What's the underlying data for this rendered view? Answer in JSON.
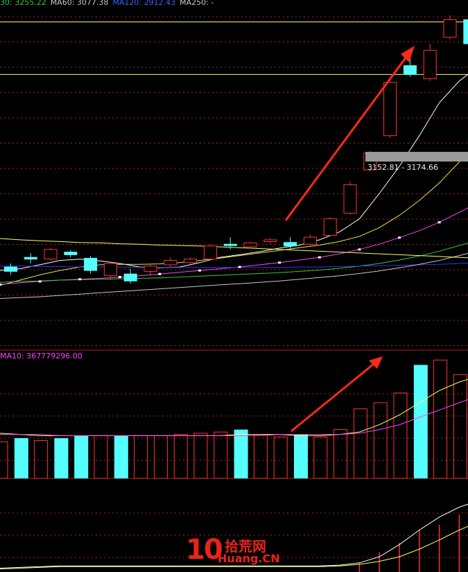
{
  "legend": {
    "items": [
      {
        "text": "30: 3255.22",
        "color": "#33cc33"
      },
      {
        "text": "MA60: 3077.38",
        "color": "#c8c8c8"
      },
      {
        "text": "MA120: 2912.43",
        "color": "#3366ff"
      },
      {
        "text": "MA250: -",
        "color": "#c8c8c8"
      }
    ]
  },
  "volume_legend": {
    "text": "MA10: 367779296.00",
    "color": "#ff44ff"
  },
  "range_label": "3152.81 - 3174.66",
  "logo": {
    "num": "10",
    "cn": "拾荒网",
    "en": "Huang.CN"
  },
  "colors": {
    "up": "#ff3333",
    "down": "#55ffff",
    "grid": "#aa2222"
  },
  "chart_data": [
    {
      "type": "candlestick",
      "panel": "price",
      "ylim": [
        2600,
        3400
      ],
      "hlines": [
        3350,
        3230
      ],
      "candles": [
        {
          "o": 2790,
          "c": 2780,
          "h": 2798,
          "l": 2772
        },
        {
          "o": 2812,
          "c": 2808,
          "h": 2822,
          "l": 2798
        },
        {
          "o": 2808,
          "c": 2830,
          "h": 2834,
          "l": 2805
        },
        {
          "o": 2824,
          "c": 2818,
          "h": 2828,
          "l": 2812
        },
        {
          "o": 2810,
          "c": 2782,
          "h": 2815,
          "l": 2775
        },
        {
          "o": 2770,
          "c": 2798,
          "h": 2800,
          "l": 2760
        },
        {
          "o": 2774,
          "c": 2758,
          "h": 2785,
          "l": 2752
        },
        {
          "o": 2780,
          "c": 2792,
          "h": 2795,
          "l": 2772
        },
        {
          "o": 2795,
          "c": 2805,
          "h": 2812,
          "l": 2790
        },
        {
          "o": 2800,
          "c": 2808,
          "h": 2812,
          "l": 2796
        },
        {
          "o": 2808,
          "c": 2838,
          "h": 2842,
          "l": 2805
        },
        {
          "o": 2842,
          "c": 2840,
          "h": 2858,
          "l": 2830
        },
        {
          "o": 2836,
          "c": 2845,
          "h": 2848,
          "l": 2832
        },
        {
          "o": 2848,
          "c": 2852,
          "h": 2856,
          "l": 2843
        },
        {
          "o": 2846,
          "c": 2838,
          "h": 2858,
          "l": 2832
        },
        {
          "o": 2842,
          "c": 2858,
          "h": 2864,
          "l": 2838
        },
        {
          "o": 2862,
          "c": 2900,
          "h": 2904,
          "l": 2860
        },
        {
          "o": 2913,
          "c": 2978,
          "h": 2985,
          "l": 2910
        },
        {
          "o": 3012,
          "c": 3050,
          "h": 3055,
          "l": 3008
        },
        {
          "o": 3090,
          "c": 3212,
          "h": 3214,
          "l": 3085
        },
        {
          "o": 3250,
          "c": 3230,
          "h": 3280,
          "l": 3225
        },
        {
          "o": 3220,
          "c": 3285,
          "h": 3300,
          "l": 3215
        },
        {
          "o": 3315,
          "c": 3355,
          "h": 3365,
          "l": 3310
        },
        {
          "o": 3355,
          "c": 3300,
          "h": 3370,
          "l": 3290
        }
      ],
      "series": [
        {
          "color": "#ffffff",
          "values": [
            2782,
            2786,
            2795,
            2805,
            2808,
            2804,
            2798,
            2790,
            2788,
            2790,
            2800,
            2812,
            2818,
            2825,
            2833,
            2840,
            2852,
            2870,
            2900,
            2958,
            3020,
            3090,
            3165,
            3215,
            3250
          ]
        },
        {
          "color": "#e8e84a",
          "values": [
            2748,
            2760,
            2772,
            2782,
            2790,
            2795,
            2796,
            2796,
            2797,
            2800,
            2805,
            2810,
            2816,
            2822,
            2828,
            2834,
            2840,
            2848,
            2860,
            2880,
            2908,
            2942,
            2982,
            3030,
            3080
          ]
        },
        {
          "color": "#ff44ff",
          "values": [
            2750,
            2754,
            2757,
            2760,
            2762,
            2764,
            2767,
            2770,
            2774,
            2778,
            2782,
            2786,
            2790,
            2795,
            2800,
            2806,
            2812,
            2820,
            2830,
            2842,
            2857,
            2873,
            2892,
            2915,
            2938
          ]
        },
        {
          "color": "#33cc33",
          "values": [
            2755,
            2757,
            2758,
            2760,
            2761,
            2762,
            2763,
            2764,
            2765,
            2767,
            2769,
            2771,
            2773,
            2775,
            2777,
            2780,
            2783,
            2787,
            2792,
            2798,
            2806,
            2815,
            2826,
            2839,
            2852
          ]
        },
        {
          "color": "#3333ff",
          "values": [
            2792,
            2792,
            2791,
            2791,
            2790,
            2790,
            2790,
            2789,
            2789,
            2789,
            2789,
            2789,
            2789,
            2789,
            2789,
            2790,
            2790,
            2791,
            2792,
            2793,
            2794,
            2795,
            2796,
            2798,
            2800
          ]
        },
        {
          "color": "#c8c8c8",
          "values": [
            2718,
            2720,
            2722,
            2725,
            2728,
            2731,
            2734,
            2737,
            2740,
            2743,
            2746,
            2749,
            2752,
            2755,
            2758,
            2762,
            2766,
            2770,
            2775,
            2781,
            2788,
            2796,
            2805,
            2816,
            2828
          ]
        },
        {
          "color": "#ffff66",
          "values": [
            2855,
            2852,
            2850,
            2848,
            2846,
            2845,
            2843,
            2842,
            2840,
            2839,
            2838,
            2836,
            2834,
            2832,
            2830,
            2828,
            2826,
            2824,
            2822,
            2820,
            2818,
            2816,
            2814,
            2812,
            2810
          ]
        }
      ]
    },
    {
      "type": "bar",
      "panel": "volume",
      "ylim": [
        0,
        100
      ],
      "values": [
        30,
        33,
        31,
        33,
        35,
        35,
        35,
        35,
        35,
        36,
        37,
        38,
        40,
        36,
        34,
        36,
        34,
        40,
        57,
        62,
        70,
        93,
        97,
        85,
        89,
        80
      ],
      "up": [
        true,
        false,
        true,
        false,
        false,
        true,
        false,
        true,
        true,
        true,
        true,
        true,
        false,
        true,
        true,
        false,
        true,
        true,
        true,
        true,
        true,
        false,
        true,
        true,
        false
      ],
      "series": [
        {
          "color": "#ffff66",
          "values": [
            37,
            36,
            35,
            35,
            35,
            35,
            35,
            35,
            35,
            35,
            35,
            35,
            36,
            36,
            36,
            35,
            35,
            36,
            38,
            44,
            52,
            62,
            72,
            79,
            84,
            86
          ]
        },
        {
          "color": "#ff44ff",
          "values": [
            36,
            36,
            36,
            35,
            35,
            35,
            35,
            35,
            35,
            35,
            35,
            35,
            35,
            35,
            36,
            36,
            36,
            36,
            37,
            40,
            44,
            50,
            56,
            62,
            68,
            72
          ]
        }
      ]
    },
    {
      "type": "bar",
      "panel": "indicator",
      "ylim": [
        0,
        100
      ],
      "values": [
        0,
        0,
        0,
        0,
        0,
        0,
        0,
        0,
        0,
        0,
        0,
        0,
        0,
        0,
        0,
        0,
        0,
        0,
        12,
        26,
        38,
        55,
        62,
        75,
        88,
        95
      ],
      "series": [
        {
          "color": "#ffffff",
          "values": [
            5,
            6,
            7,
            8,
            8,
            8,
            8,
            8,
            8,
            8,
            8,
            8,
            8,
            8,
            8,
            8,
            8,
            9,
            12,
            20,
            36,
            55,
            72,
            85,
            94,
            98
          ]
        },
        {
          "color": "#ffff66",
          "values": [
            4,
            5,
            6,
            7,
            7,
            7,
            7,
            7,
            7,
            7,
            7,
            7,
            7,
            7,
            7,
            7,
            7,
            8,
            10,
            14,
            20,
            30,
            42,
            55,
            66,
            74
          ]
        }
      ]
    }
  ]
}
